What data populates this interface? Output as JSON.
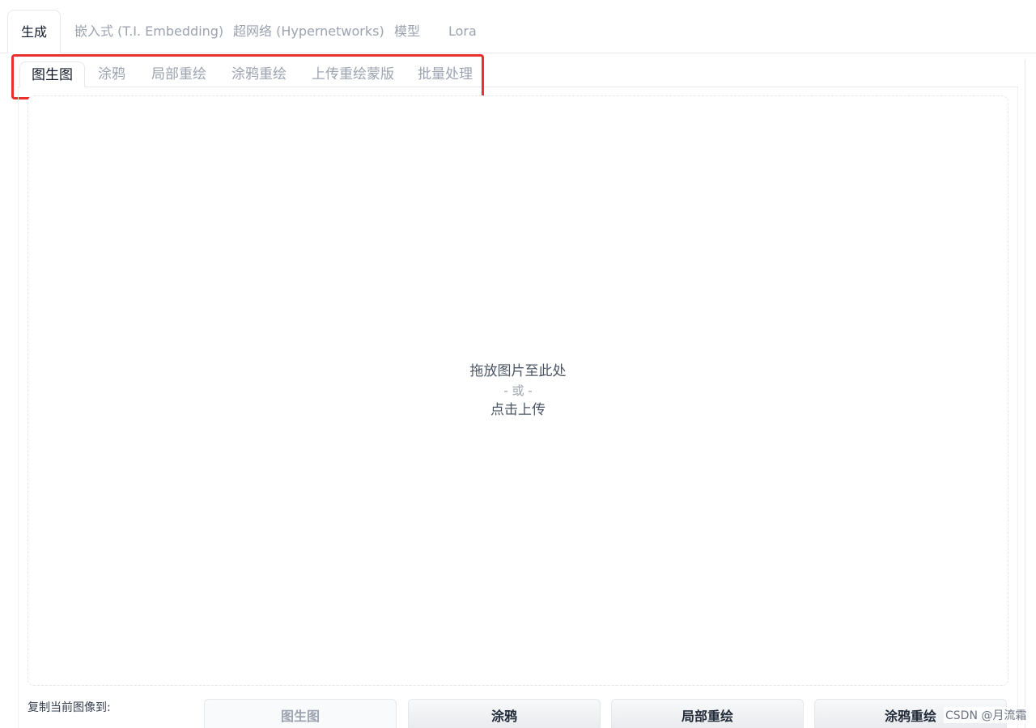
{
  "top_tabs": [
    {
      "label": "生成",
      "active": true
    },
    {
      "label": "嵌入式 (T.I. Embedding)",
      "active": false
    },
    {
      "label": "超网络 (Hypernetworks)",
      "active": false
    },
    {
      "label": "模型",
      "active": false
    },
    {
      "label": "Lora",
      "active": false
    }
  ],
  "sub_tabs": [
    {
      "label": "图生图",
      "active": true
    },
    {
      "label": "涂鸦",
      "active": false
    },
    {
      "label": "局部重绘",
      "active": false
    },
    {
      "label": "涂鸦重绘",
      "active": false
    },
    {
      "label": "上传重绘蒙版",
      "active": false
    },
    {
      "label": "批量处理",
      "active": false
    }
  ],
  "upload": {
    "drop_text": "拖放图片至此处",
    "or_text": "- 或 -",
    "click_text": "点击上传"
  },
  "copy_to": {
    "label": "复制当前图像到:",
    "buttons": [
      "图生图",
      "涂鸦",
      "局部重绘",
      "涂鸦重绘"
    ]
  },
  "watermark": "CSDN @月流霜",
  "colors": {
    "highlight": "#e8302c",
    "active_text": "#111827",
    "inactive_text": "#9ca3af"
  }
}
